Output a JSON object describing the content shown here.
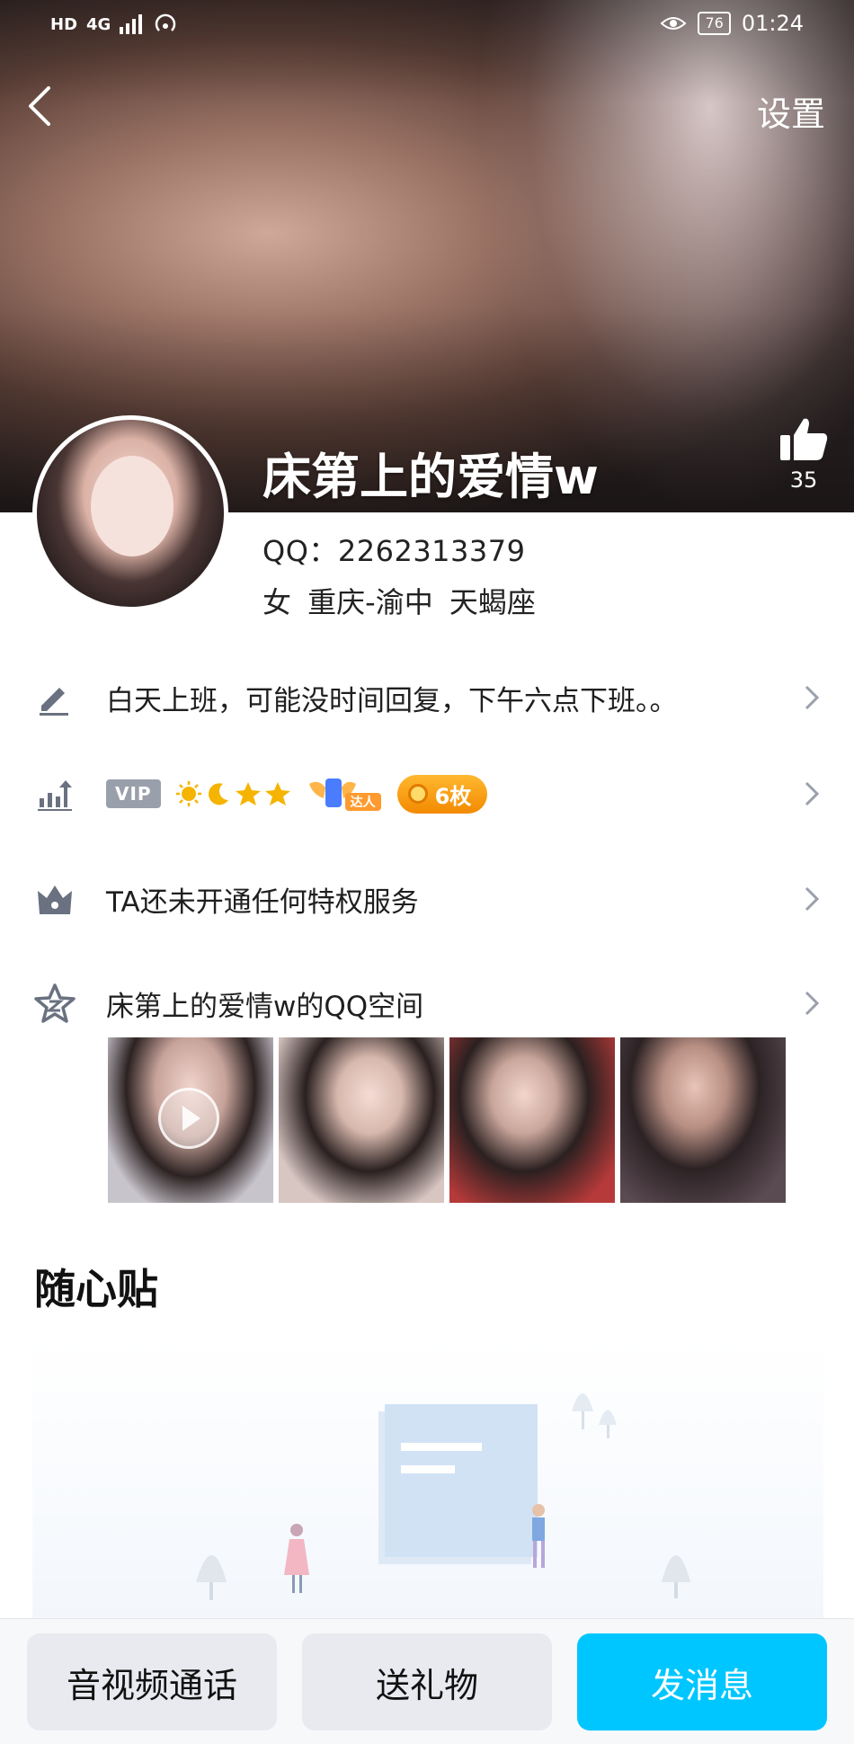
{
  "status_bar": {
    "network": "HD",
    "signal": "4G",
    "battery": "76",
    "time": "01:24"
  },
  "header": {
    "settings_label": "设置",
    "likes_count": "35"
  },
  "profile": {
    "nickname": "床第上的爱情w",
    "qq": "QQ：2262313379",
    "gender_location": "女  重庆-渝中  天蝎座"
  },
  "rows": {
    "signature": "白天上班，可能没时间回复，下午六点下班。。",
    "vip_label": "VIP",
    "daren_label": "达人",
    "medal_label": "6枚",
    "privilege": "TA还未开通任何特权服务",
    "qzone": "床第上的爱情w的QQ空间"
  },
  "section": {
    "title": "随心贴"
  },
  "bottom_bar": {
    "call": "音视频通话",
    "gift": "送礼物",
    "message": "发消息"
  },
  "colors": {
    "accent": "#00c6ff",
    "medal": "#f59a00",
    "vip": "#9aa0ab"
  }
}
